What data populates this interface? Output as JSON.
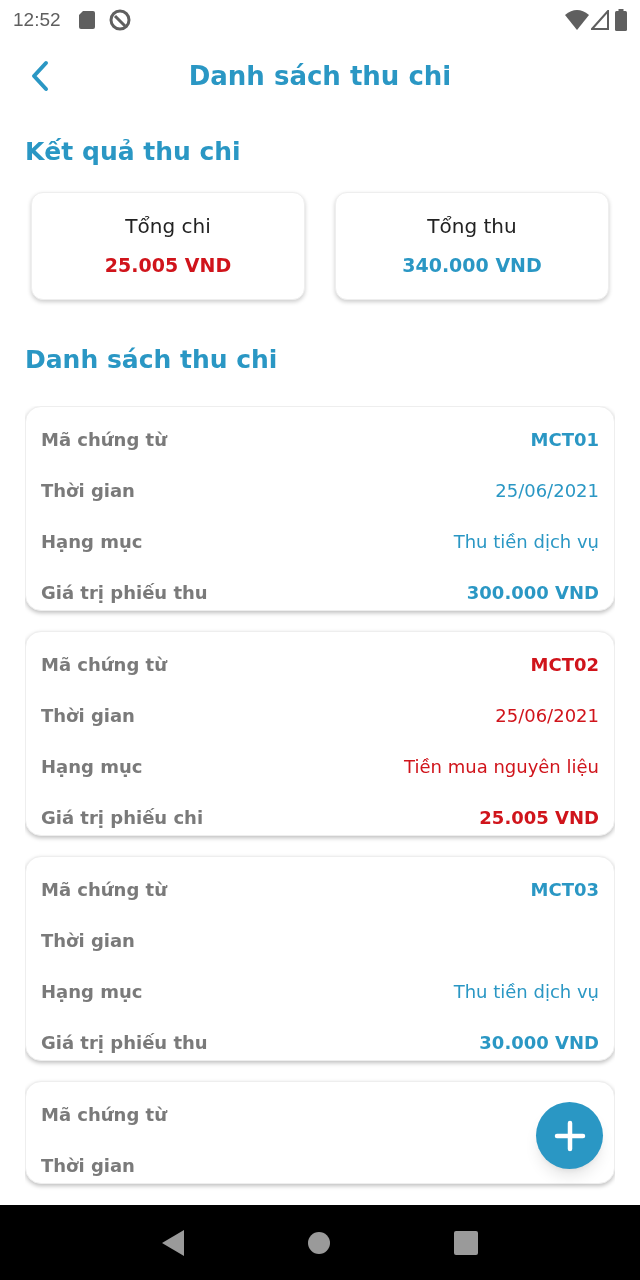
{
  "status_bar": {
    "time": "12:52"
  },
  "header": {
    "title": "Danh sách thu chi"
  },
  "summary": {
    "title": "Kết quả thu chi",
    "cards": [
      {
        "label": "Tổng chi",
        "value": "25.005 VND",
        "kind": "expense"
      },
      {
        "label": "Tổng thu",
        "value": "340.000 VND",
        "kind": "income"
      }
    ]
  },
  "list": {
    "title": "Danh sách thu chi",
    "items": [
      {
        "kind": "income",
        "rows": [
          {
            "label": "Mã chứng từ",
            "value": "MCT01",
            "kind": "code"
          },
          {
            "label": "Thời gian",
            "value": "25/06/2021",
            "kind": "date"
          },
          {
            "label": "Hạng mục",
            "value": "Thu tiền dịch vụ",
            "kind": "category"
          },
          {
            "label": "Giá trị phiếu thu",
            "value": "300.000 VND",
            "kind": "amount"
          }
        ]
      },
      {
        "kind": "expense",
        "rows": [
          {
            "label": "Mã chứng từ",
            "value": "MCT02",
            "kind": "code"
          },
          {
            "label": "Thời gian",
            "value": "25/06/2021",
            "kind": "date"
          },
          {
            "label": "Hạng mục",
            "value": "Tiền mua nguyên liệu",
            "kind": "category"
          },
          {
            "label": "Giá trị phiếu chi",
            "value": "25.005 VND",
            "kind": "amount"
          }
        ]
      },
      {
        "kind": "income",
        "rows": [
          {
            "label": "Mã chứng từ",
            "value": "MCT03",
            "kind": "code"
          },
          {
            "label": "Thời gian"
          },
          {
            "label": "Hạng mục",
            "value": "Thu tiền dịch vụ",
            "kind": "category"
          },
          {
            "label": "Giá trị phiếu thu",
            "value": "30.000 VND",
            "kind": "amount"
          }
        ]
      },
      {
        "rows": [
          {
            "label": "Mã chứng từ"
          },
          {
            "label": "Thời gian"
          }
        ]
      }
    ]
  }
}
